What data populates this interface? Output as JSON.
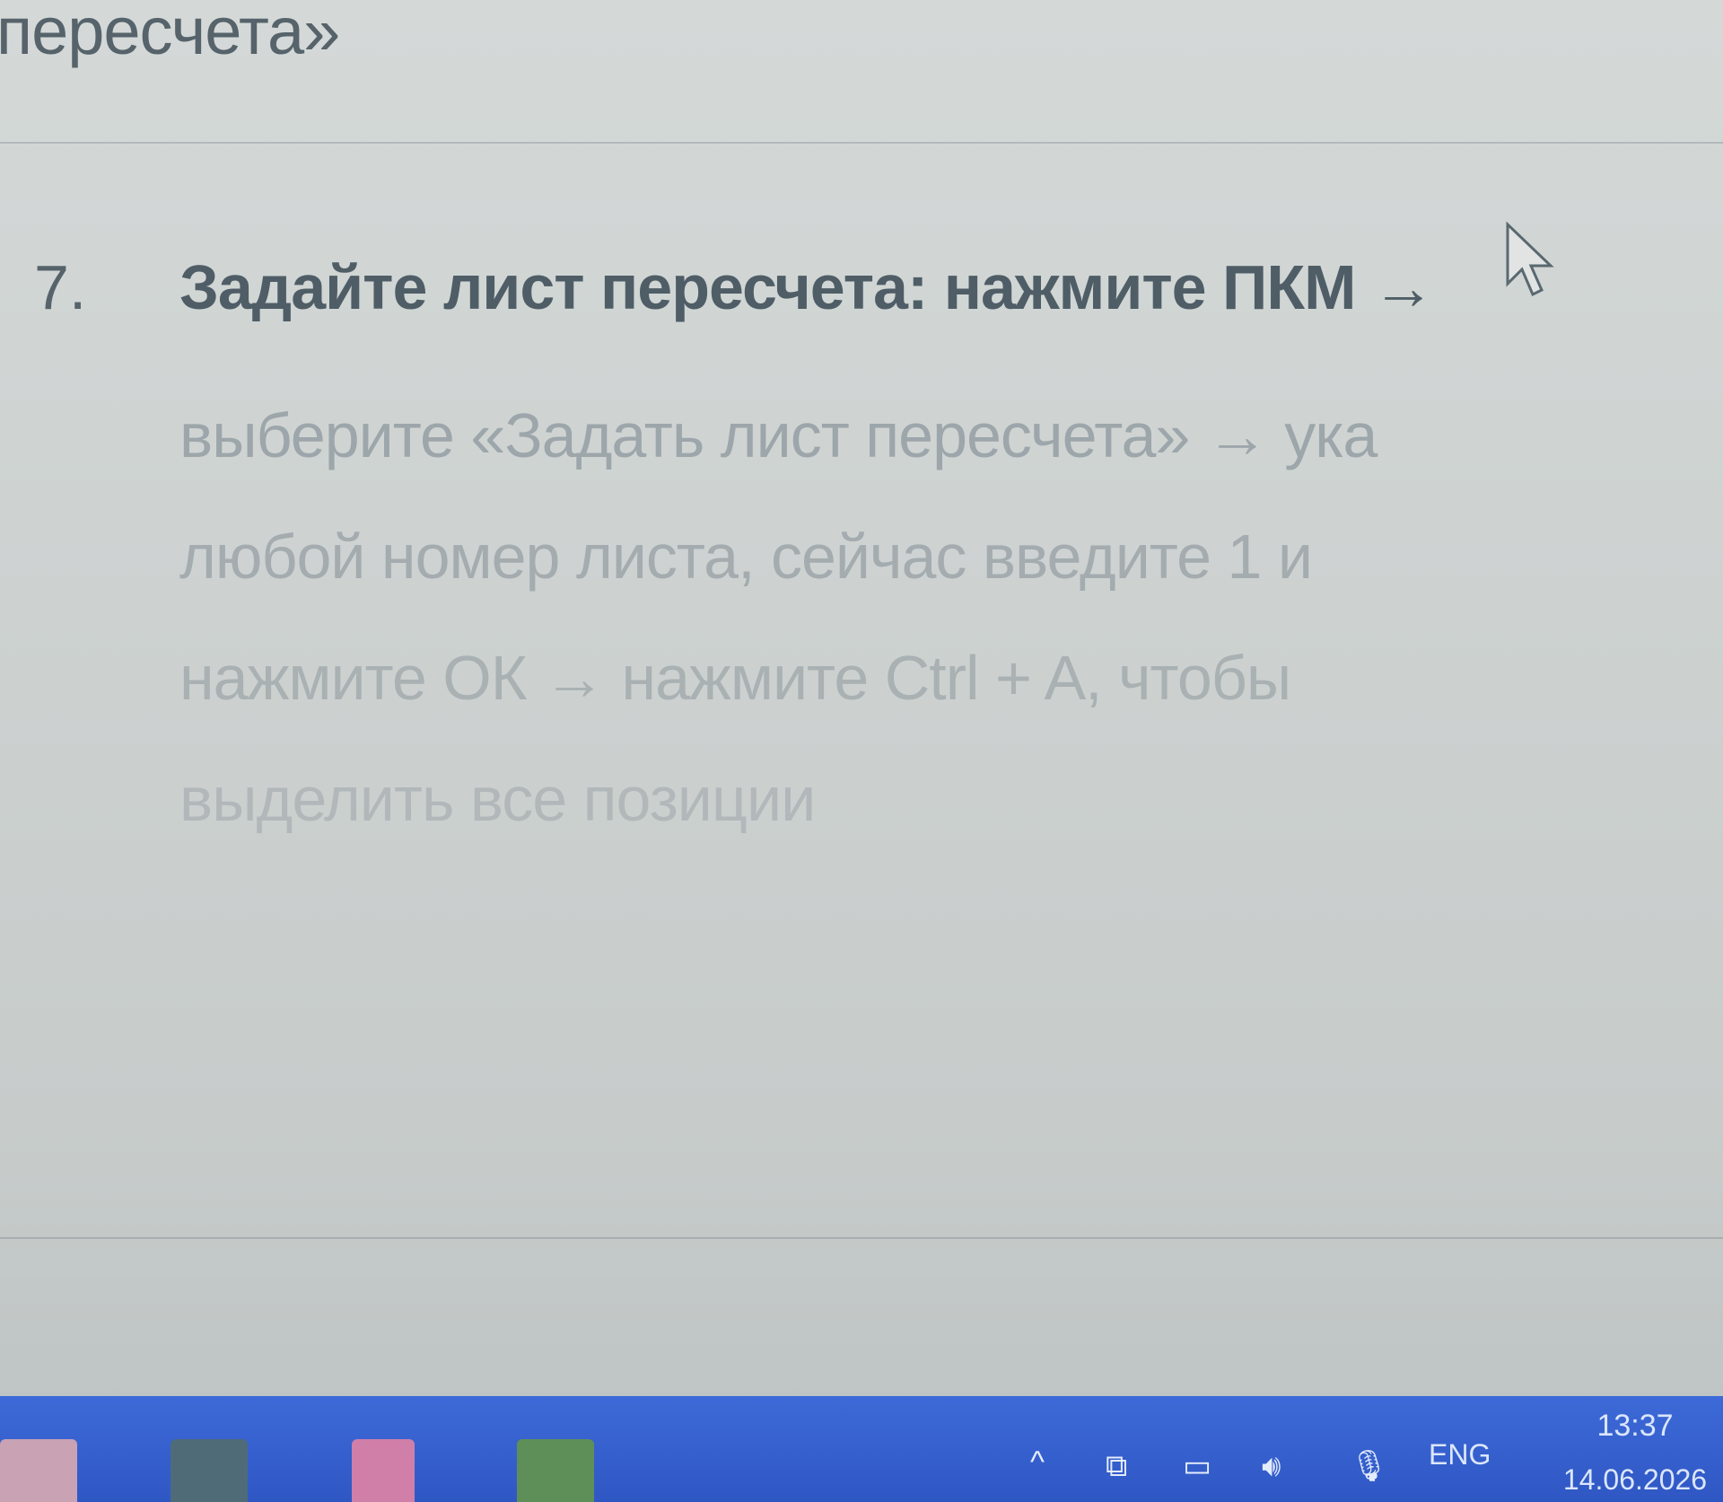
{
  "document": {
    "previous_line": "пересчета»",
    "step": {
      "number": "7.",
      "line1": "Задайте лист пересчета: нажмите ПКМ →",
      "line2": "выберите «Задать лист пересчета» → ука",
      "line3": "любой номер листа, сейчас введите 1 и",
      "line4": "нажмите ОК → нажмите Ctrl + A, чтобы",
      "line5": "выделить все позиции"
    },
    "colors": {
      "text_bold": "#4f5d66",
      "text_faded": "#a6aeb1",
      "background": "#cdd2d1"
    }
  },
  "cursor": {
    "icon": "mouse-pointer-icon"
  },
  "taskbar": {
    "color": "#3d6ad8",
    "apps": [
      {
        "name": "app-icon-1"
      },
      {
        "name": "app-icon-2"
      },
      {
        "name": "app-icon-3"
      },
      {
        "name": "app-icon-4"
      }
    ],
    "tray": {
      "chevron_icon": "^",
      "meet_icon": "⧉",
      "network_icon": "▭",
      "volume_icon": "🔊︎",
      "mic_icon": "🎙︎",
      "language": "ENG",
      "time": "13:37",
      "date": "14.06.2026"
    }
  }
}
